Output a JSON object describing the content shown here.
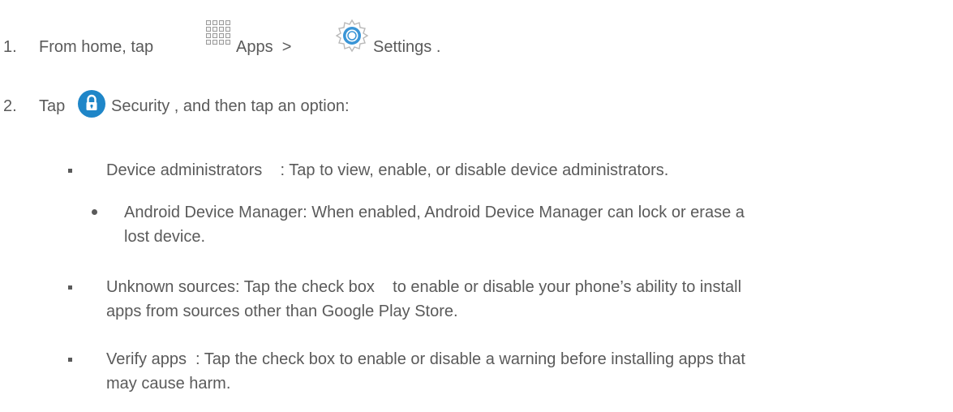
{
  "steps": [
    {
      "number": "1.",
      "text_a": "From home, tap",
      "icon_a": "apps-grid-icon",
      "text_b": "Apps  >",
      "icon_b": "settings-gear-icon",
      "text_c": "Settings ."
    },
    {
      "number": "2.",
      "text_a": "Tap",
      "icon_a": "security-lock-icon",
      "text_b": "Security , and then tap an option:"
    }
  ],
  "options": [
    {
      "text": "Device administrators    : Tap to view, enable, or disable device administrators.",
      "sub": [
        {
          "line1": "Android Device Manager: When enabled, Android Device Manager can lock or erase a",
          "line2": "lost device."
        }
      ]
    },
    {
      "line1": "Unknown sources: Tap the check box    to enable or disable your phone’s ability to install",
      "line2": "apps from sources other than Google Play Store."
    },
    {
      "line1": "Verify apps  : Tap the check box to enable or disable a warning before installing apps that",
      "line2": "may cause harm."
    }
  ],
  "colors": {
    "text": "#5a5a5a",
    "security_icon": "#1f86c8",
    "settings_icon": "#3a95d6"
  }
}
